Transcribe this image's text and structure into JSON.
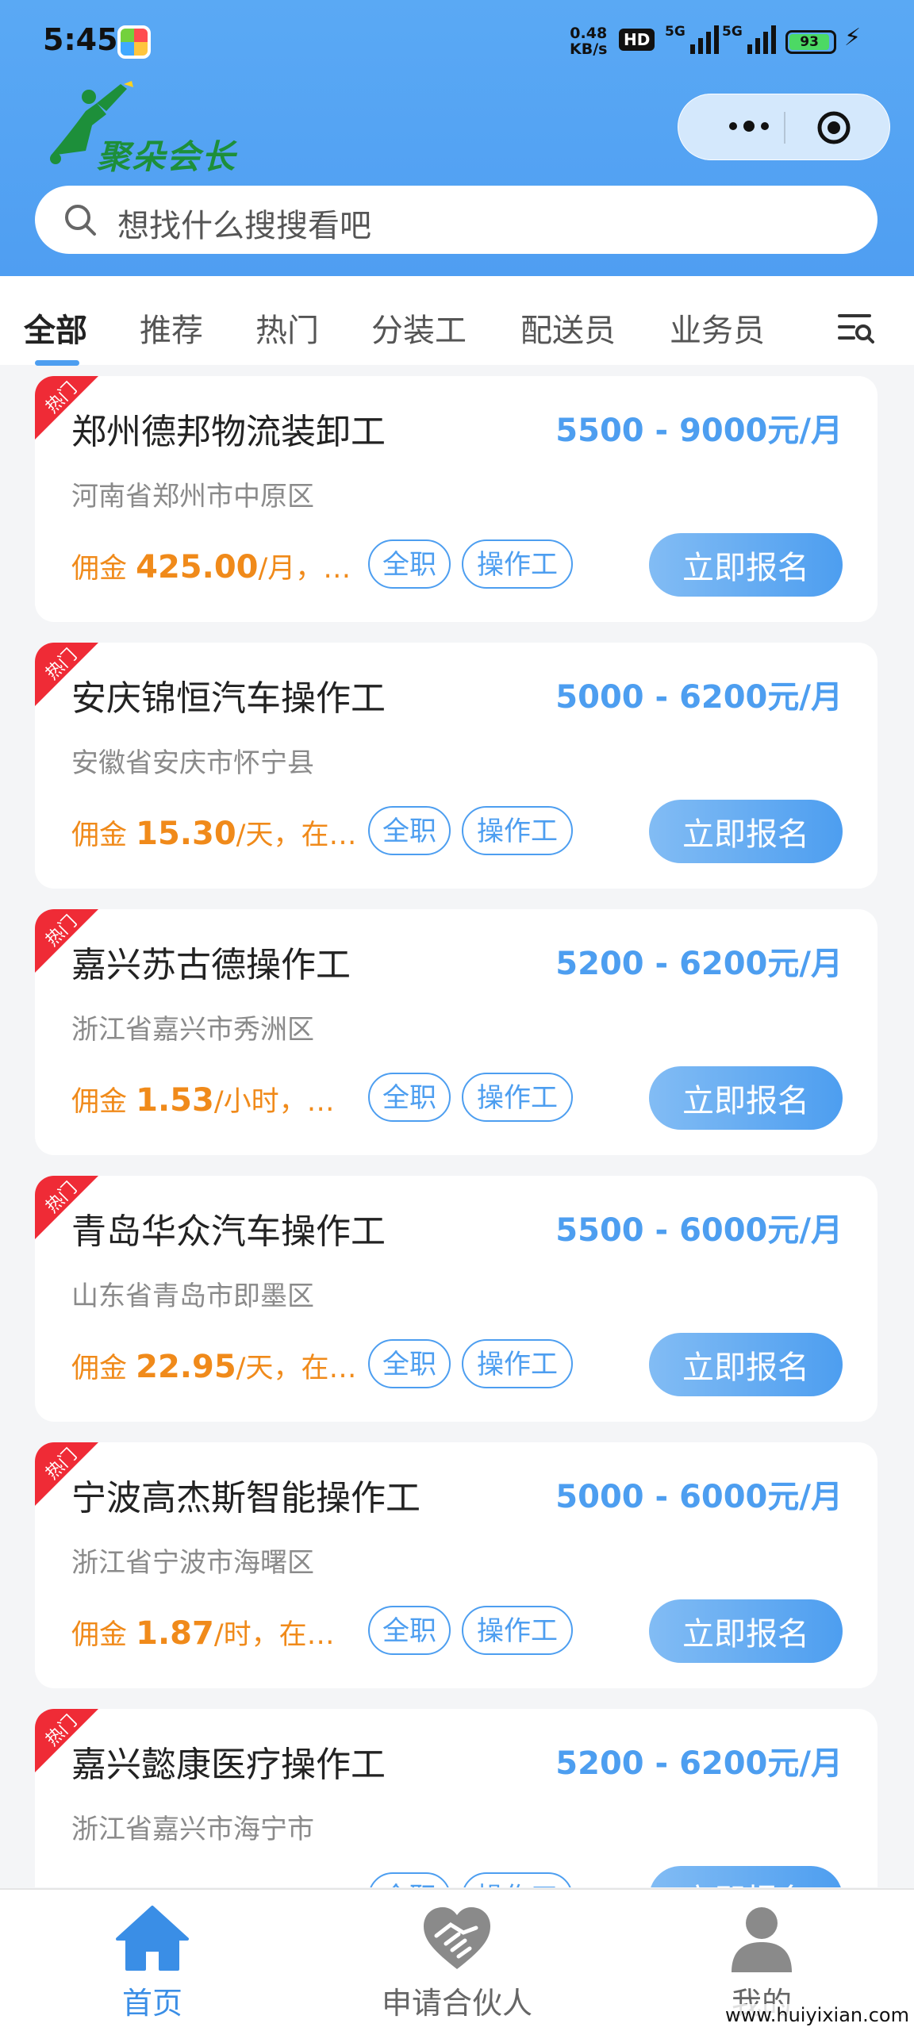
{
  "status_bar": {
    "time": "5:45",
    "speed_value": "0.48",
    "speed_unit": "KB/s",
    "hd_label": "HD",
    "network1": "5G",
    "network2": "5G",
    "battery": "93"
  },
  "app": {
    "logo_text": "聚朵会长"
  },
  "search": {
    "placeholder": "想找什么搜搜看吧"
  },
  "tabs": [
    {
      "label": "全部",
      "active": true
    },
    {
      "label": "推荐"
    },
    {
      "label": "热门"
    },
    {
      "label": "分装工"
    },
    {
      "label": "配送员"
    },
    {
      "label": "业务员"
    }
  ],
  "jobs": [
    {
      "badge": "热门",
      "title": "郑州德邦物流装卸工",
      "salary": "5500 - 9000元/月",
      "location": "河南省郑州市中原区",
      "commission_prefix": "佣金 ",
      "commission_value": "425.00",
      "commission_suffix": "/月，…",
      "tag1": "全职",
      "tag2": "操作工",
      "action": "立即报名"
    },
    {
      "badge": "热门",
      "title": "安庆锦恒汽车操作工",
      "salary": "5000 - 6200元/月",
      "location": "安徽省安庆市怀宁县",
      "commission_prefix": "佣金 ",
      "commission_value": "15.30",
      "commission_suffix": "/天，在…",
      "tag1": "全职",
      "tag2": "操作工",
      "action": "立即报名"
    },
    {
      "badge": "热门",
      "title": "嘉兴苏古德操作工",
      "salary": "5200 - 6200元/月",
      "location": "浙江省嘉兴市秀洲区",
      "commission_prefix": "佣金 ",
      "commission_value": "1.53",
      "commission_suffix": "/小时，…",
      "tag1": "全职",
      "tag2": "操作工",
      "action": "立即报名"
    },
    {
      "badge": "热门",
      "title": "青岛华众汽车操作工",
      "salary": "5500 - 6000元/月",
      "location": "山东省青岛市即墨区",
      "commission_prefix": "佣金 ",
      "commission_value": "22.95",
      "commission_suffix": "/天，在…",
      "tag1": "全职",
      "tag2": "操作工",
      "action": "立即报名"
    },
    {
      "badge": "热门",
      "title": "宁波高杰斯智能操作工",
      "salary": "5000 - 6000元/月",
      "location": "浙江省宁波市海曙区",
      "commission_prefix": "佣金 ",
      "commission_value": "1.87",
      "commission_suffix": "/时，在…",
      "tag1": "全职",
      "tag2": "操作工",
      "action": "立即报名"
    },
    {
      "badge": "热门",
      "title": "嘉兴懿康医疗操作工",
      "salary": "5200 - 6200元/月",
      "location": "浙江省嘉兴市海宁市",
      "commission_prefix": "佣金 ",
      "commission_value": "",
      "commission_suffix": "",
      "tag1": "全职",
      "tag2": "操作工",
      "action": "立即报名"
    }
  ],
  "bottom_nav": [
    {
      "label": "首页",
      "icon": "home-icon",
      "active": true
    },
    {
      "label": "申请合伙人",
      "icon": "handshake-icon"
    },
    {
      "label": "我的",
      "icon": "user-icon"
    }
  ],
  "watermark": "www.huiyixian.com",
  "colors": {
    "primary": "#4d9ef0",
    "header": "#5aa9f4",
    "commission": "#f08a1a",
    "badge": "#ef2b36"
  }
}
